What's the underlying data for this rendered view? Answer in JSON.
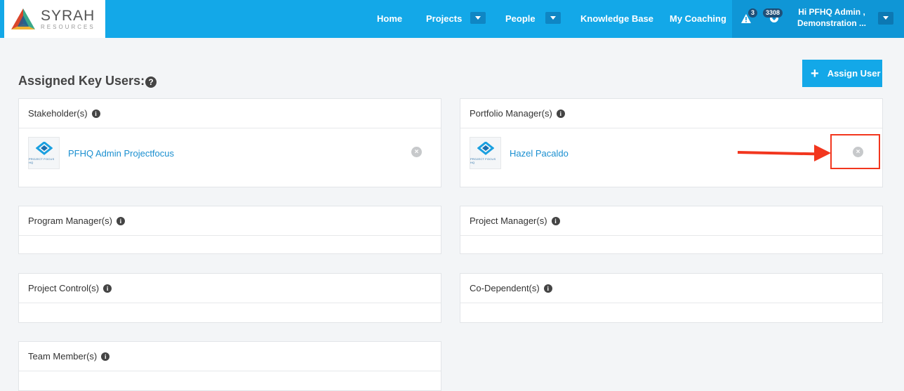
{
  "brand": {
    "name": "SYRAH",
    "tagline": "RESOURCES"
  },
  "nav": {
    "home": "Home",
    "projects": "Projects",
    "people": "People",
    "knowledge_base": "Knowledge Base",
    "my_coaching": "My Coaching"
  },
  "notifications": {
    "alerts_count": "3",
    "updates_count": "3308"
  },
  "user_menu": {
    "greeting_line1": "Hi PFHQ Admin ,",
    "greeting_line2": "Demonstration ..."
  },
  "page": {
    "title": "Assigned Key Users:",
    "assign_button": "Assign User"
  },
  "panels": {
    "stakeholders": {
      "title": "Stakeholder(s)",
      "users": [
        {
          "name": "PFHQ Admin Projectfocus",
          "logo_caption": "PROJECT FOCUS HQ"
        }
      ]
    },
    "portfolio_managers": {
      "title": "Portfolio Manager(s)",
      "users": [
        {
          "name": "Hazel Pacaldo",
          "logo_caption": "PROJECT FOCUS HQ"
        }
      ]
    },
    "program_managers": {
      "title": "Program Manager(s)"
    },
    "project_managers": {
      "title": "Project Manager(s)"
    },
    "project_control": {
      "title": "Project Control(s)"
    },
    "co_dependents": {
      "title": "Co-Dependent(s)"
    },
    "team_members": {
      "title": "Team Member(s)"
    }
  },
  "colors": {
    "primary": "#13a8e8",
    "annotation": "#f2361e",
    "link": "#1a8fd0"
  }
}
